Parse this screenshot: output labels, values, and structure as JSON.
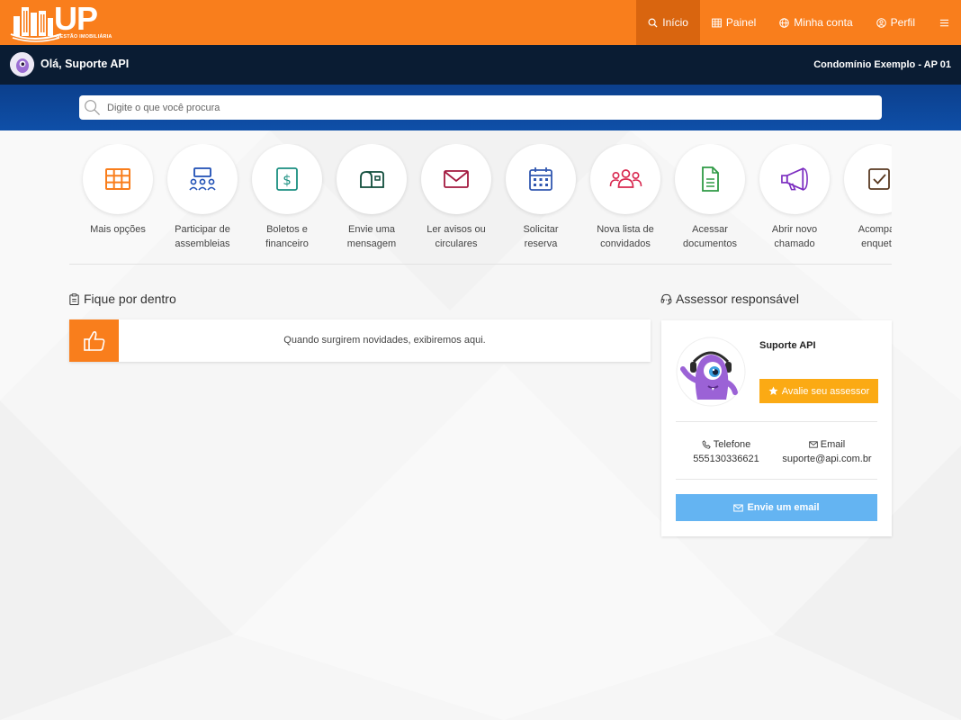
{
  "brand": {
    "name": "UP",
    "tagline": "GESTÃO IMOBILIÁRIA",
    "color": "#f97e1c"
  },
  "nav": {
    "items": [
      {
        "label": "Início",
        "icon": "search-icon",
        "active": true
      },
      {
        "label": "Painel",
        "icon": "grid-icon"
      },
      {
        "label": "Minha conta",
        "icon": "globe-icon"
      },
      {
        "label": "Perfil",
        "icon": "user-circle-icon"
      }
    ],
    "menu_icon": "hamburger-icon"
  },
  "userbar": {
    "greeting": "Olá, Suporte API",
    "condo": "Condomínio Exemplo - AP 01"
  },
  "search": {
    "placeholder": "Digite o que você procura"
  },
  "actions": [
    {
      "line1": "Mais opções",
      "line2": "",
      "icon": "grid-icon",
      "color": "#f97e1c"
    },
    {
      "line1": "Participar de",
      "line2": "assembleias",
      "icon": "meeting-icon",
      "color": "#1f4fb5"
    },
    {
      "line1": "Boletos e",
      "line2": "financeiro",
      "icon": "dollar-icon",
      "color": "#1a8f80"
    },
    {
      "line1": "Envie uma",
      "line2": "mensagem",
      "icon": "mailbox-icon",
      "color": "#0f4c3a"
    },
    {
      "line1": "Ler avisos ou",
      "line2": "circulares",
      "icon": "envelope-icon",
      "color": "#a3193f"
    },
    {
      "line1": "Solicitar",
      "line2": "reserva",
      "icon": "calendar-icon",
      "color": "#3157b0"
    },
    {
      "line1": "Nova lista de",
      "line2": "convidados",
      "icon": "users-icon",
      "color": "#d8284f"
    },
    {
      "line1": "Acessar",
      "line2": "documentos",
      "icon": "document-icon",
      "color": "#2f9a45"
    },
    {
      "line1": "Abrir novo",
      "line2": "chamado",
      "icon": "megaphone-icon",
      "color": "#7b2cc0"
    },
    {
      "line1": "Acompan",
      "line2": "enquete",
      "icon": "checkbox-icon",
      "color": "#5a3a22"
    }
  ],
  "news": {
    "title": "Fique por dentro",
    "empty_text": "Quando surgirem novidades, exibiremos aqui.",
    "icon": "thumbs-up-icon"
  },
  "advisor": {
    "title": "Assessor responsável",
    "name": "Suporte API",
    "rate_label": "Avalie seu assessor",
    "phone_label": "Telefone",
    "phone": "555130336621",
    "email_label": "Email",
    "email": "suporte@api.com.br",
    "email_button": "Envie um email"
  },
  "colors": {
    "nav_active": "#d9650f",
    "userbar": "#0a1c33",
    "search_strip": "#0e4fa8",
    "rate_button": "#fbaa14",
    "email_button": "#64b4f2"
  }
}
